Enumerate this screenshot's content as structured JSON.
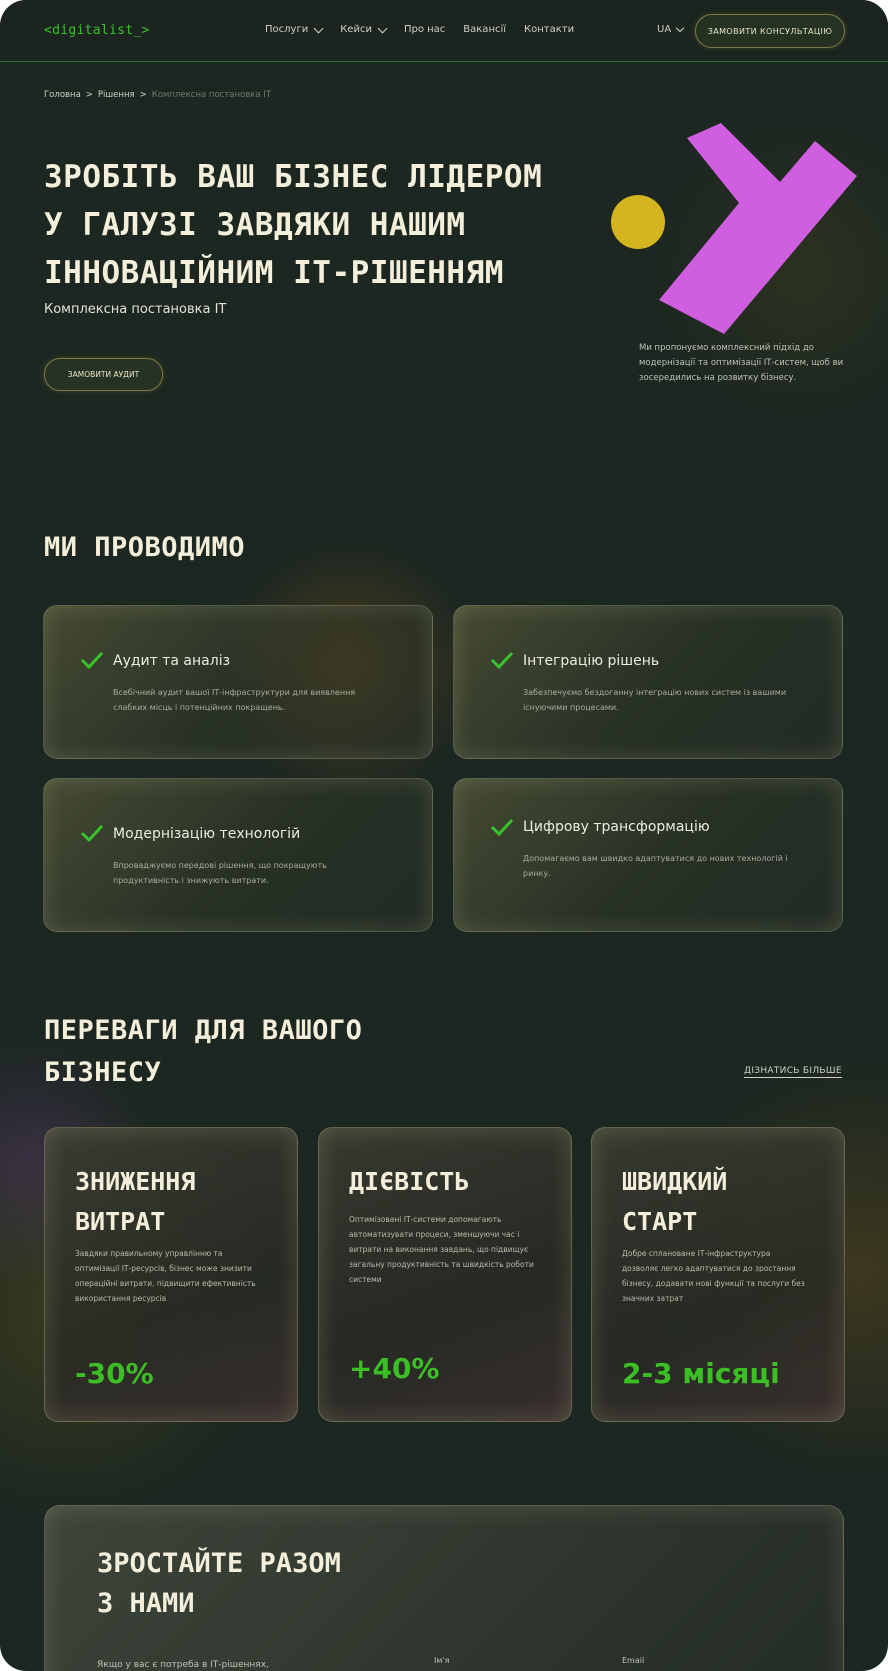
{
  "header": {
    "logo": "<digitalist_>",
    "nav": [
      "Послуги",
      "Кейси",
      "Про нас",
      "Вакансії",
      "Контакти"
    ],
    "lang": "UA",
    "cta": "ЗАМОВИТИ КОНСУЛЬТАЦІЮ"
  },
  "breadcrumb": [
    "Головна",
    ">",
    "Рішення",
    ">",
    "Комплексна постановка ІТ"
  ],
  "hero": {
    "title_lines": [
      "ЗРОБІТЬ ВАШ БІЗНЕС ЛІДЕРОМ",
      "У ГАЛУЗІ ЗАВДЯКИ НАШИМ",
      "ІННОВАЦІЙНИМ ІТ-РІШЕННЯМ"
    ],
    "subtitle": "Комплексна постановка ІТ",
    "button": "ЗАМОВИТИ АУДИТ",
    "note": "Ми пропонуємо комплексний підхід до модернізації та оптимізації ІТ-систем, щоб ви зосередились на розвитку бізнесу.",
    "colors": {
      "circle": "#d4b41f",
      "shape": "#d05ee0"
    }
  },
  "services": {
    "title": "МИ ПРОВОДИМО",
    "items": [
      {
        "title": "Аудит та аналіз",
        "desc": "Всебічний аудит вашої ІТ-інфраструктури для виявлення слабких місць і потенційних покращень."
      },
      {
        "title": "Інтеграцію рішень",
        "desc": "Забезпечуємо бездоганну інтеграцію нових систем із вашими існуючими процесами."
      },
      {
        "title": "Модернізацію технологій",
        "desc": "Впроваджуємо передові рішення, що покращують продуктивність і знижують витрати."
      },
      {
        "title": "Цифрову трансформацію",
        "desc": "Допомагаємо вам швидко адаптуватися до нових технологій і ринку."
      }
    ]
  },
  "benefits": {
    "title_lines": [
      "ПЕРЕВАГИ ДЛЯ ВАШОГО",
      "БІЗНЕСУ"
    ],
    "more": "ДІЗНАТИСЬ БІЛЬШЕ",
    "items": [
      {
        "title_lines": [
          "ЗНИЖЕННЯ",
          "ВИТРАТ"
        ],
        "desc": "Завдяки правильному управлінню та оптимізації ІТ-ресурсів, бізнес може знизити операційні витрати, підвищити ефективність використання ресурсів",
        "stat": "-30%"
      },
      {
        "title_lines": [
          "ДІЄВІСТЬ"
        ],
        "desc": "Оптимізовані ІТ-системи допомагають автоматизувати процеси, зменшуючи час і витрати на виконання завдань, що підвищує загальну продуктивність та швидкість роботи системи",
        "stat": "+40%"
      },
      {
        "title_lines": [
          "ШВИДКИЙ",
          "СТАРТ"
        ],
        "desc": "Добре сплановане ІТ-інфраструктура дозволяє легко адаптуватися до зростання бізнесу, додавати нові функції та послуги без значних затрат",
        "stat": "2-3 місяці"
      }
    ]
  },
  "grow": {
    "title_lines": [
      "ЗРОСТАЙТЕ РАЗОМ",
      "З НАМИ"
    ],
    "text": "Якщо у вас є потреба в ІТ-рішеннях,",
    "label_name": "Ім'я",
    "label_email": "Email"
  },
  "accent": "#38c22b"
}
